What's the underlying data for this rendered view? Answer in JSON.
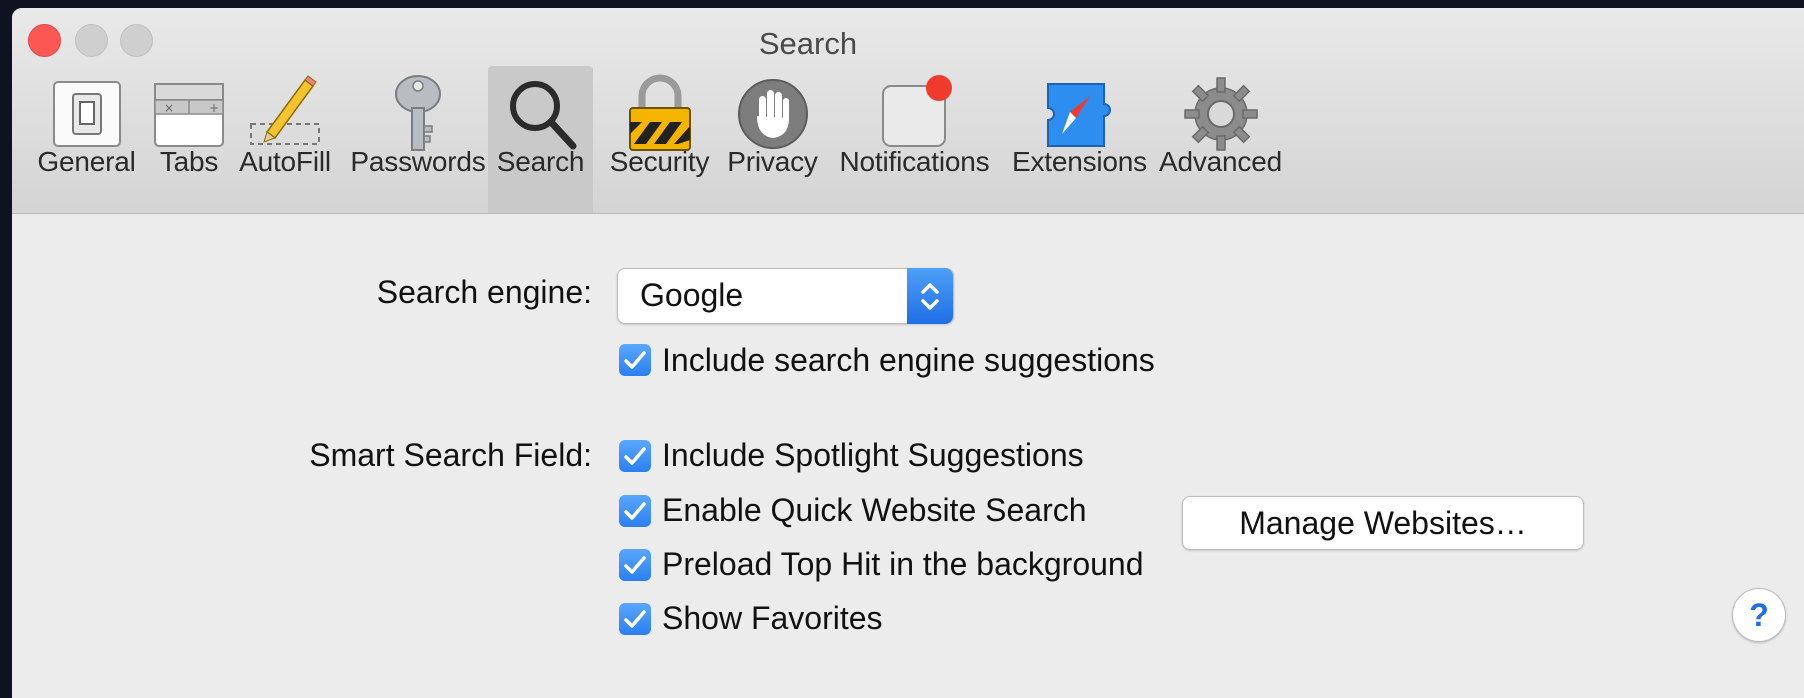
{
  "window": {
    "title": "Search"
  },
  "toolbar": {
    "items": [
      {
        "label": "General",
        "icon": "general-switch-icon"
      },
      {
        "label": "Tabs",
        "icon": "tabs-icon"
      },
      {
        "label": "AutoFill",
        "icon": "pencil-autofill-icon"
      },
      {
        "label": "Passwords",
        "icon": "key-icon"
      },
      {
        "label": "Search",
        "icon": "magnifier-icon",
        "selected": true
      },
      {
        "label": "Security",
        "icon": "padlock-icon"
      },
      {
        "label": "Privacy",
        "icon": "hand-icon"
      },
      {
        "label": "Notifications",
        "icon": "notification-badge-icon"
      },
      {
        "label": "Extensions",
        "icon": "puzzle-compass-icon"
      },
      {
        "label": "Advanced",
        "icon": "gear-icon"
      }
    ]
  },
  "search": {
    "engine_label": "Search engine:",
    "engine_value": "Google",
    "include_suggestions_label": "Include search engine suggestions",
    "include_suggestions_checked": true,
    "smart_field_label": "Smart Search Field:",
    "spotlight_label": "Include Spotlight Suggestions",
    "spotlight_checked": true,
    "quick_search_label": "Enable Quick Website Search",
    "quick_search_checked": true,
    "manage_button": "Manage Websites…",
    "preload_label": "Preload Top Hit in the background",
    "preload_checked": true,
    "favorites_label": "Show Favorites",
    "favorites_checked": true
  },
  "help": {
    "glyph": "?"
  },
  "colors": {
    "accent": "#2b7ff0",
    "close": "#fc5753",
    "window_bg": "#ececec",
    "desktop_bg": "#0f1220"
  }
}
